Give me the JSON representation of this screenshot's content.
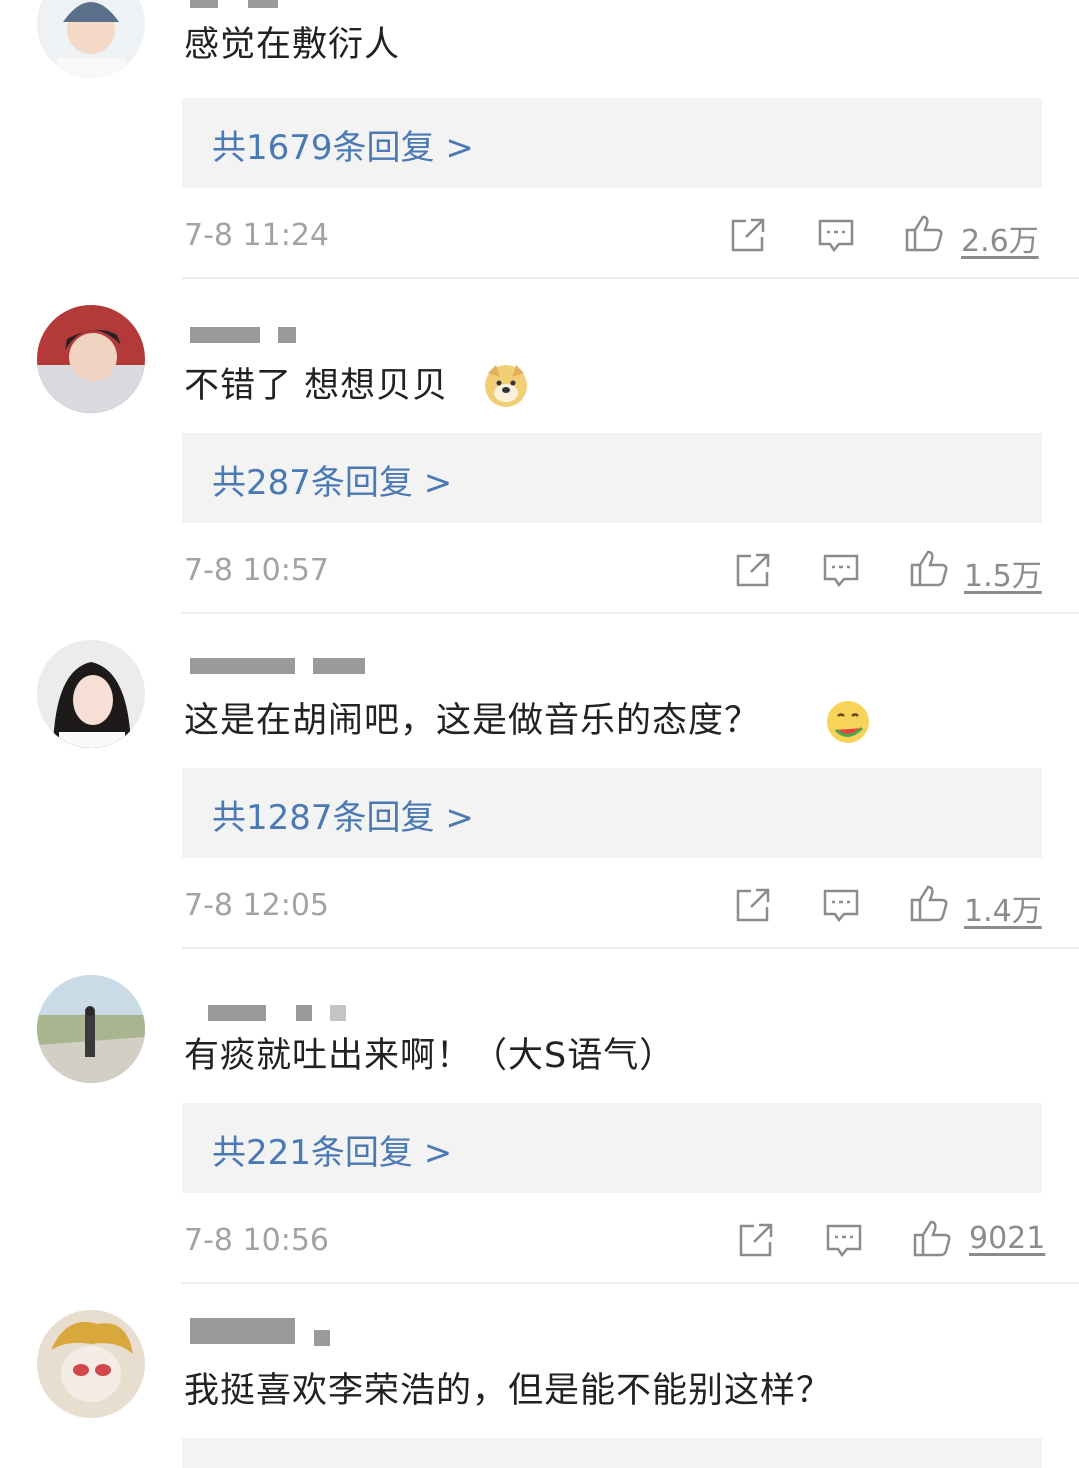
{
  "comments": [
    {
      "text": "感觉在敷衍人",
      "replies": "共1679条回复 >",
      "time": "7-8 11:24",
      "likes": "2.6万",
      "avatar": "avatar-boy-helmet",
      "emoji": null
    },
    {
      "text": "不错了 想想贝贝",
      "replies": "共287条回复 >",
      "time": "7-8 10:57",
      "likes": "1.5万",
      "avatar": "avatar-young-man",
      "emoji": "doge-emoji"
    },
    {
      "text": "这是在胡闹吧，这是做音乐的态度？",
      "replies": "共1287条回复 >",
      "time": "7-8 12:05",
      "likes": "1.4万",
      "avatar": "avatar-girl",
      "emoji": "eating-watermelon-emoji"
    },
    {
      "text": "有痰就吐出来啊！（大S语气）",
      "replies": "共221条回复 >",
      "time": "7-8 10:56",
      "likes": "9021",
      "avatar": "avatar-outdoor-scene",
      "emoji": null
    },
    {
      "text": "我挺喜欢李荣浩的，但是能不能别这样？",
      "replies": "",
      "time": "",
      "likes": "",
      "avatar": "avatar-cartoon-character",
      "emoji": null
    }
  ],
  "icons": {
    "share": "share-icon",
    "comment": "comment-icon",
    "like": "thumbs-up-icon"
  },
  "colors": {
    "reply_link": "#4a79b4",
    "reply_bg": "#f3f3f3",
    "meta_text": "#a3a3a3",
    "body_text": "#222222"
  }
}
